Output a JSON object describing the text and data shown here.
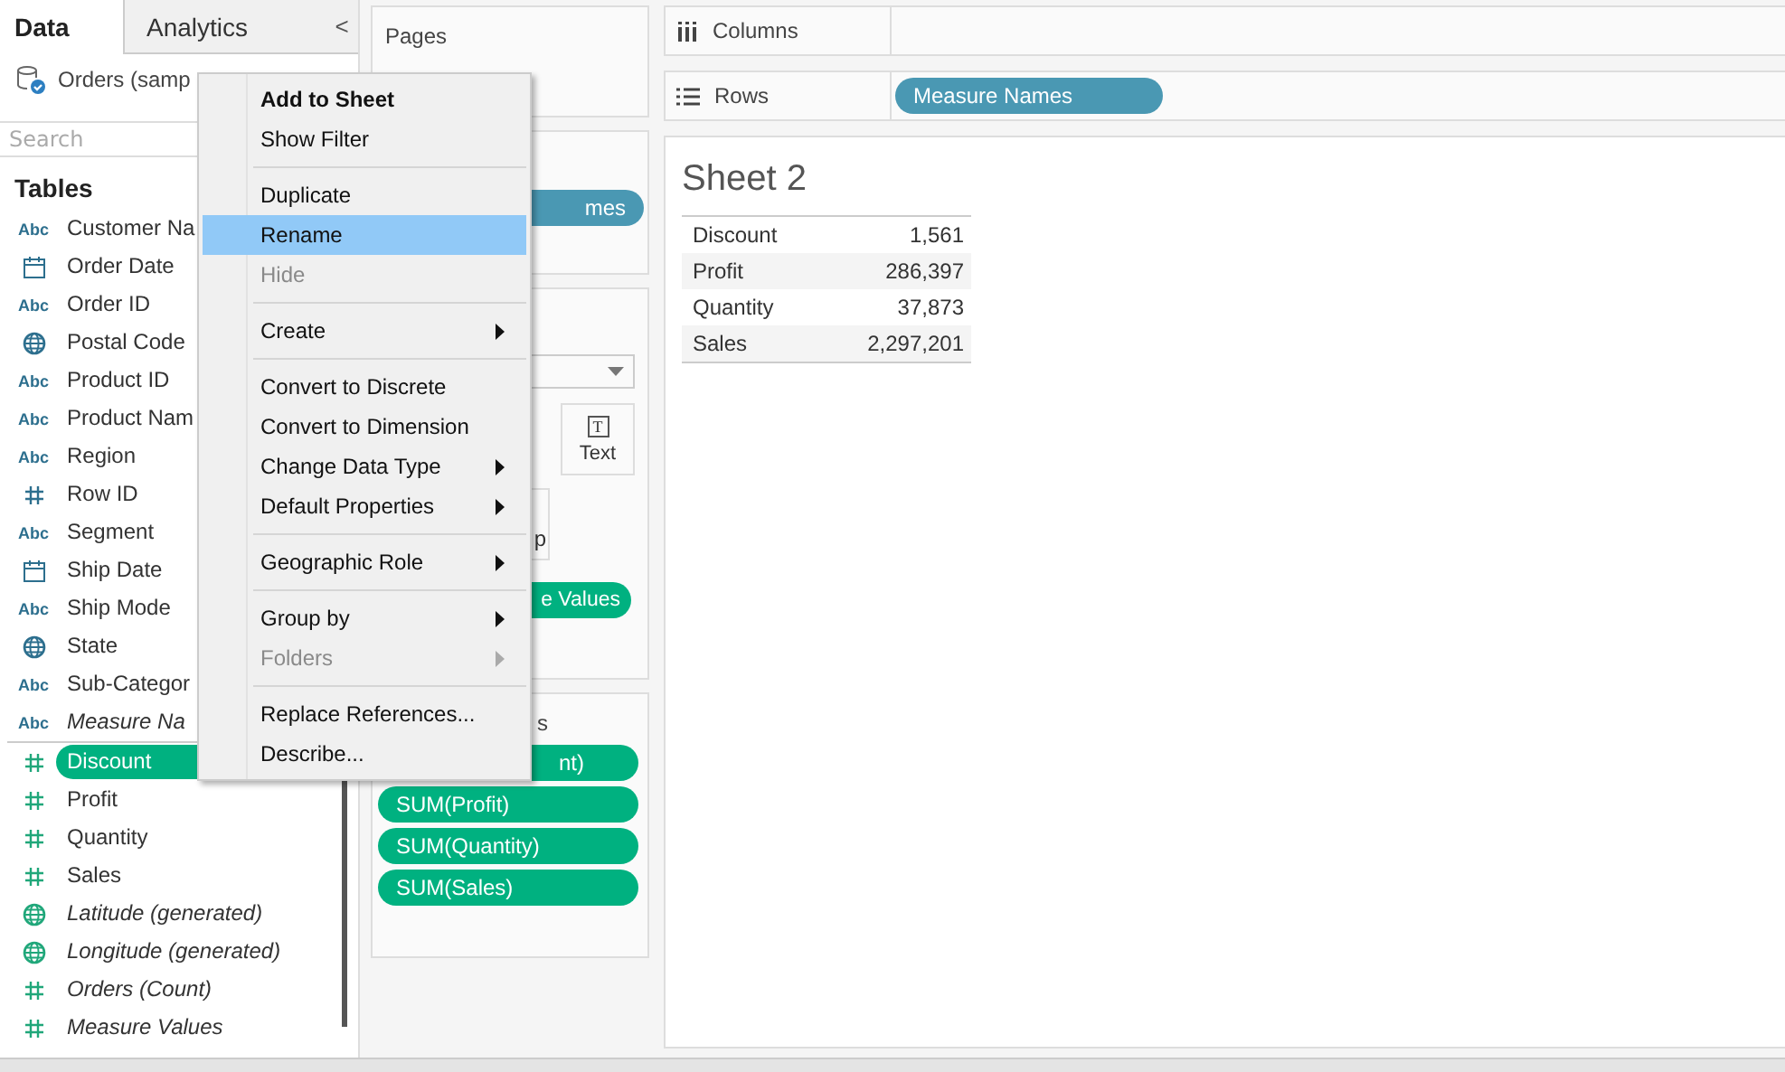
{
  "left_tabs": [
    {
      "label": "Data",
      "selected": true
    },
    {
      "label": "Analytics",
      "selected": false
    }
  ],
  "collapse": "<",
  "data_source": "Orders (samp",
  "search": {
    "placeholder": "Search"
  },
  "tables_title": "Tables",
  "fields": [
    {
      "label": "Customer Na",
      "kind": "abc",
      "glyph": "Abc",
      "color": "#2d6f8e",
      "italic": false,
      "selected": false
    },
    {
      "label": "Order Date",
      "kind": "date",
      "color": "#2d6f8e",
      "italic": false,
      "selected": false
    },
    {
      "label": "Order ID",
      "kind": "abc",
      "glyph": "Abc",
      "color": "#2d6f8e",
      "italic": false,
      "selected": false
    },
    {
      "label": "Postal Code",
      "kind": "globe",
      "color": "#2d6f8e",
      "italic": false,
      "selected": false
    },
    {
      "label": "Product ID",
      "kind": "abc",
      "glyph": "Abc",
      "color": "#2d6f8e",
      "italic": false,
      "selected": false
    },
    {
      "label": "Product Nam",
      "kind": "abc",
      "glyph": "Abc",
      "color": "#2d6f8e",
      "italic": false,
      "selected": false
    },
    {
      "label": "Region",
      "kind": "abc",
      "glyph": "Abc",
      "color": "#2d6f8e",
      "italic": false,
      "selected": false
    },
    {
      "label": "Row ID",
      "kind": "number",
      "color": "#2d6f8e",
      "italic": false,
      "selected": false
    },
    {
      "label": "Segment",
      "kind": "abc",
      "glyph": "Abc",
      "color": "#2d6f8e",
      "italic": false,
      "selected": false
    },
    {
      "label": "Ship Date",
      "kind": "date",
      "color": "#2d6f8e",
      "italic": false,
      "selected": false
    },
    {
      "label": "Ship Mode",
      "kind": "abc",
      "glyph": "Abc",
      "color": "#2d6f8e",
      "italic": false,
      "selected": false
    },
    {
      "label": "State",
      "kind": "globe",
      "color": "#2d6f8e",
      "italic": false,
      "selected": false
    },
    {
      "label": "Sub-Categor",
      "kind": "abc",
      "glyph": "Abc",
      "color": "#2d6f8e",
      "italic": false,
      "selected": false
    },
    {
      "label": "Measure Na",
      "kind": "abc",
      "glyph": "Abc",
      "color": "#2d6f8e",
      "italic": true,
      "selected": false
    },
    {
      "label": "Discount",
      "kind": "number",
      "color": "#20a77a",
      "italic": false,
      "selected": true,
      "group_start": true
    },
    {
      "label": "Profit",
      "kind": "number",
      "color": "#20a77a",
      "italic": false,
      "selected": false
    },
    {
      "label": "Quantity",
      "kind": "number",
      "color": "#20a77a",
      "italic": false,
      "selected": false
    },
    {
      "label": "Sales",
      "kind": "number",
      "color": "#20a77a",
      "italic": false,
      "selected": false
    },
    {
      "label": "Latitude (generated)",
      "kind": "globe",
      "color": "#20a77a",
      "italic": true,
      "selected": false
    },
    {
      "label": "Longitude (generated)",
      "kind": "globe",
      "color": "#20a77a",
      "italic": true,
      "selected": false
    },
    {
      "label": "Orders (Count)",
      "kind": "number",
      "color": "#20a77a",
      "italic": true,
      "selected": false
    },
    {
      "label": "Measure Values",
      "kind": "number",
      "color": "#20a77a",
      "italic": true,
      "selected": false
    }
  ],
  "pages_card": {
    "title": "Pages"
  },
  "filters_card": {
    "pill": "mes"
  },
  "marks_card": {
    "text_button": {
      "glyph": "T",
      "label": "Text"
    },
    "partial_button": "p",
    "pill": "e Values"
  },
  "measure_values_card": {
    "title": "s",
    "pills": [
      "nt)",
      "SUM(Profit)",
      "SUM(Quantity)",
      "SUM(Sales)"
    ]
  },
  "columns_shelf": {
    "label": "Columns"
  },
  "rows_shelf": {
    "label": "Rows",
    "pill": "Measure Names"
  },
  "sheet": {
    "title": "Sheet 2",
    "rows": [
      {
        "name": "Discount",
        "value": "1,561"
      },
      {
        "name": "Profit",
        "value": "286,397"
      },
      {
        "name": "Quantity",
        "value": "37,873"
      },
      {
        "name": "Sales",
        "value": "2,297,201"
      }
    ]
  },
  "context_menu": [
    {
      "kind": "item",
      "label": "Add to Sheet",
      "bold": true,
      "selected": false
    },
    {
      "kind": "item",
      "label": "Show Filter",
      "selected": false
    },
    {
      "kind": "separator"
    },
    {
      "kind": "item",
      "label": "Duplicate",
      "selected": false
    },
    {
      "kind": "item",
      "label": "Rename",
      "selected": true
    },
    {
      "kind": "item",
      "label": "Hide",
      "disabled": true,
      "selected": false
    },
    {
      "kind": "separator"
    },
    {
      "kind": "item",
      "label": "Create",
      "submenu": true,
      "selected": false
    },
    {
      "kind": "separator"
    },
    {
      "kind": "item",
      "label": "Convert to Discrete",
      "selected": false
    },
    {
      "kind": "item",
      "label": "Convert to Dimension",
      "selected": false
    },
    {
      "kind": "item",
      "label": "Change Data Type",
      "submenu": true,
      "selected": false
    },
    {
      "kind": "item",
      "label": "Default Properties",
      "submenu": true,
      "selected": false
    },
    {
      "kind": "separator"
    },
    {
      "kind": "item",
      "label": "Geographic Role",
      "submenu": true,
      "selected": false
    },
    {
      "kind": "separator"
    },
    {
      "kind": "item",
      "label": "Group by",
      "submenu": true,
      "selected": false
    },
    {
      "kind": "item",
      "label": "Folders",
      "disabled": true,
      "submenu": true,
      "selected": false
    },
    {
      "kind": "separator"
    },
    {
      "kind": "item",
      "label": "Replace References...",
      "selected": false
    },
    {
      "kind": "item",
      "label": "Describe...",
      "selected": false
    }
  ]
}
